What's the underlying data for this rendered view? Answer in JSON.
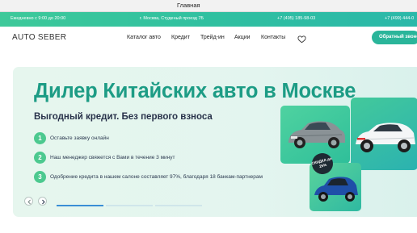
{
  "browser": {
    "tab_title": "Главная"
  },
  "topbar": {
    "hours": "Ежедневно с 9:00 до 20:00",
    "address": "г. Москва, Студеный проезд 7Б",
    "phone1": "+7 (495) 185-98-03",
    "phone2": "+7 (499) 444-0"
  },
  "nav": {
    "logo": "AUTO SEBER",
    "items": [
      "Каталог авто",
      "Кредит",
      "Трейд-ин",
      "Акции",
      "Контакты"
    ],
    "callback_button": "Обратный звонок"
  },
  "hero": {
    "title": "Дилер Китайских авто в Москве",
    "subtitle": "Выгодный кредит. Без первого взноса",
    "steps": [
      {
        "num": "1",
        "text": "Оставьте заявку онлайн"
      },
      {
        "num": "2",
        "text": "Наш менеджер свяжется с Вами в течение 3 минут"
      },
      {
        "num": "3",
        "text": "Одобрение кредита в нашем салоне составляет 97%, благодаря 18 банкам-партнерам"
      }
    ],
    "discount_badge": "СКИДКА до 25%"
  },
  "icons": {
    "favorites": "heart-icon",
    "prev": "chevron-left-icon",
    "next": "chevron-right-icon"
  },
  "colors": {
    "accent": "#2ab59a",
    "title": "#1d9c85",
    "step": "#4cc98f"
  }
}
